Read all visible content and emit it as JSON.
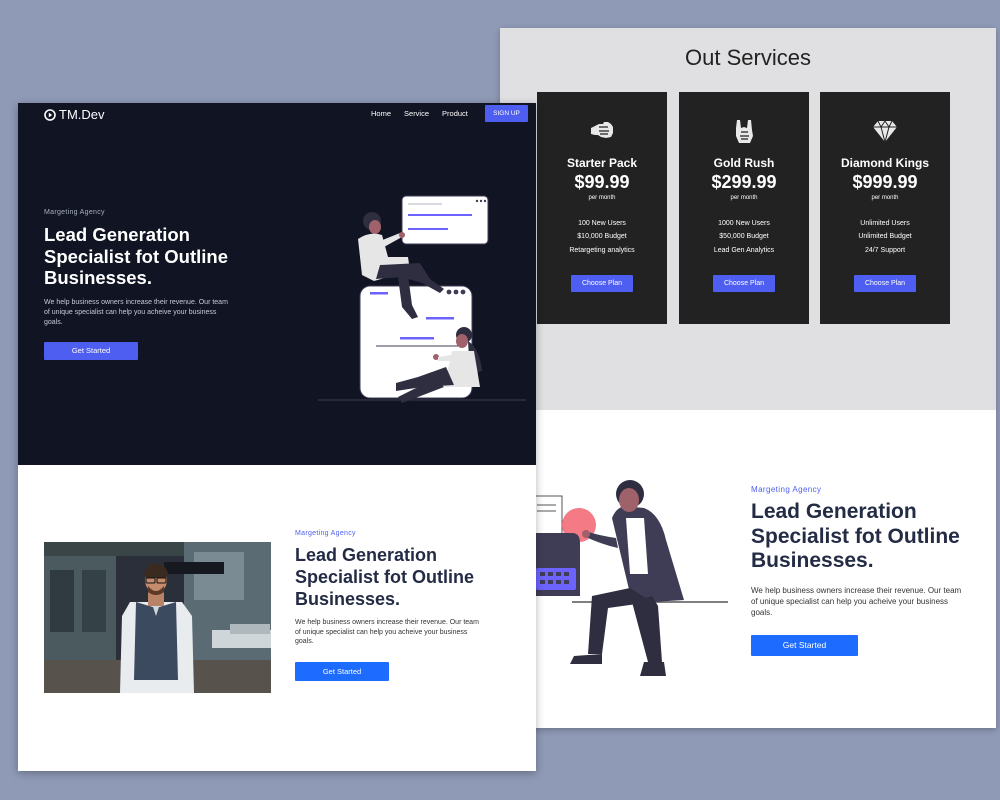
{
  "colors": {
    "background": "#8f9ab6",
    "hero_bg": "#101423",
    "accent": "#4e5ef0",
    "button_blue": "#1e6bff",
    "card_bg": "#222222",
    "services_bg": "#e0e0e2"
  },
  "front": {
    "brand": {
      "name": "TM.Dev",
      "icon": "play-circle-icon"
    },
    "nav": {
      "items": [
        "Home",
        "Service",
        "Product"
      ],
      "signup_label": "SIGN UP"
    },
    "hero": {
      "tag": "Margeting Agency",
      "title": "Lead Generation Specialist fot Outline Businesses.",
      "description": "We help business owners increase their revenue. Our team of unique specialist can help you acheive your business goals.",
      "button": "Get Started"
    },
    "about": {
      "tag": "Margeting Agency",
      "title": "Lead Generation Specialist fot Outline Businesses.",
      "description": "We help business owners increase their revenue. Our team of unique specialist can help you acheive your business goals.",
      "button": "Get Started"
    }
  },
  "services": {
    "title": "Out Services",
    "plans": [
      {
        "icon": "fist-icon",
        "name": "Starter Pack",
        "price": "$99.99",
        "period": "per month",
        "features": [
          "100 New Users",
          "$10,000 Budget",
          "Retargeting analytics"
        ],
        "button": "Choose Plan"
      },
      {
        "icon": "rock-hand-icon",
        "name": "Gold Rush",
        "price": "$299.99",
        "period": "per month",
        "features": [
          "1000 New Users",
          "$50,000 Budget",
          "Lead Gen Analytics"
        ],
        "button": "Choose Plan"
      },
      {
        "icon": "diamond-icon",
        "name": "Diamond Kings",
        "price": "$999.99",
        "period": "per month",
        "features": [
          "Unlimited Users",
          "Unlimited Budget",
          "24/7 Support"
        ],
        "button": "Choose Plan"
      }
    ]
  },
  "hero2": {
    "tag": "Margeting Agency",
    "title": "Lead Generation Specialist fot Outline Businesses.",
    "description": "We help business owners increase their revenue. Our team of unique specialist can help you acheive your business goals.",
    "button": "Get Started"
  }
}
